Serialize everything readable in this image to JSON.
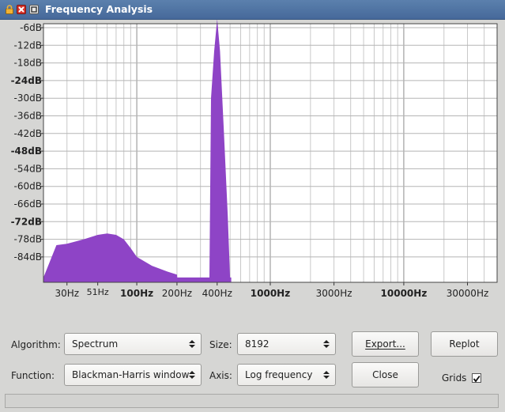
{
  "window": {
    "title": "Frequency Analysis"
  },
  "colors": {
    "spectrum_fill": "#8e44c6",
    "plot_bg": "#ffffff",
    "titlebar": "#4e72a2"
  },
  "plot": {
    "y_ticks": [
      {
        "label": "-6dB",
        "bold": false
      },
      {
        "label": "-12dB",
        "bold": false
      },
      {
        "label": "-18dB",
        "bold": false
      },
      {
        "label": "-24dB",
        "bold": true
      },
      {
        "label": "-30dB",
        "bold": false
      },
      {
        "label": "-36dB",
        "bold": false
      },
      {
        "label": "-42dB",
        "bold": false
      },
      {
        "label": "-48dB",
        "bold": true
      },
      {
        "label": "-54dB",
        "bold": false
      },
      {
        "label": "-60dB",
        "bold": false
      },
      {
        "label": "-66dB",
        "bold": false
      },
      {
        "label": "-72dB",
        "bold": true
      },
      {
        "label": "-78dB",
        "bold": false
      },
      {
        "label": "-84dB",
        "bold": false
      }
    ],
    "x_ticks": [
      {
        "label": "30Hz",
        "bold": false,
        "small": false
      },
      {
        "label": "51Hz",
        "bold": false,
        "small": true
      },
      {
        "label": "100Hz",
        "bold": true,
        "small": false
      },
      {
        "label": "200Hz",
        "bold": false,
        "small": false
      },
      {
        "label": "400Hz",
        "bold": false,
        "small": false
      },
      {
        "label": "1000Hz",
        "bold": true,
        "small": false
      },
      {
        "label": "3000Hz",
        "bold": false,
        "small": false
      },
      {
        "label": "10000Hz",
        "bold": true,
        "small": false
      },
      {
        "label": "30000Hz",
        "bold": false,
        "small": false
      }
    ]
  },
  "chart_data": {
    "type": "area",
    "x_scale": "log",
    "y_unit": "dB",
    "x_unit": "Hz",
    "grid": true,
    "series": [
      {
        "x": [
          20,
          25,
          30,
          40,
          51,
          60,
          70,
          80,
          90,
          100,
          130,
          170,
          200,
          201,
          350,
          360,
          380,
          400,
          420,
          450,
          480,
          500,
          510
        ],
        "y": [
          -91,
          -80,
          -79.5,
          -78,
          -76.5,
          -76,
          -76.5,
          -78,
          -81,
          -84,
          -87,
          -89,
          -90,
          -91,
          -91,
          -30,
          -14,
          -3,
          -14,
          -42,
          -70,
          -91,
          -91
        ]
      }
    ]
  },
  "controls": {
    "algorithm_label": "Algorithm:",
    "algorithm_value": "Spectrum",
    "size_label": "Size:",
    "size_value": "8192",
    "function_label": "Function:",
    "function_value": "Blackman-Harris window",
    "axis_label": "Axis:",
    "axis_value": "Log frequency",
    "export_button": "Export...",
    "replot_button": "Replot",
    "close_button": "Close",
    "grids_label": "Grids",
    "grids_checked": true
  }
}
